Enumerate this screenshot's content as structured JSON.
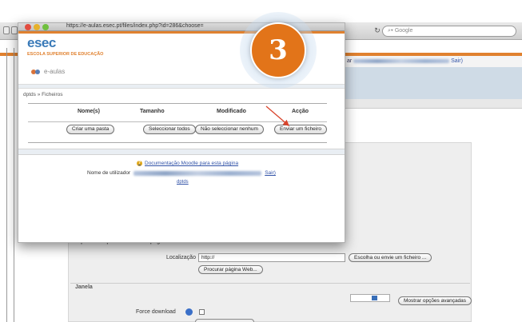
{
  "browser": {
    "url": "https://e-aulas.esec.pt/files/index.php?id=286&choose=",
    "search_placeholder": "Google"
  },
  "background": {
    "user_prefix": "ar",
    "user_suffix": "Sair)",
    "section_title": "Apontador para ficheiro ou página",
    "location_label": "Localização",
    "location_value": "http://",
    "choose_file_button": "Escolha ou envie um ficheiro ...",
    "search_web_button": "Procurar página Web...",
    "window_label": "Janela",
    "advanced_button": "Mostrar opções avançadas",
    "force_download_label": "Force download"
  },
  "popup": {
    "logo": "esec",
    "logo_subtitle": "ESCOLA SUPERIOR DE EDUCAÇÃO",
    "site_name": "e-aulas",
    "breadcrumb": "dptds » Ficheiros",
    "columns": [
      "Nome(s)",
      "Tamanho",
      "Modificado",
      "Acção"
    ],
    "buttons": {
      "create_folder": "Criar uma pasta",
      "select_all": "Seleccionar todos",
      "select_none": "Não seleccionar nenhum",
      "upload_file": "Enviar um ficheiro"
    },
    "doc_link": "Documentação Moodle para esta página",
    "login_label": "Nome de utilizador",
    "logout_link": "Sair)",
    "course_link": "dptds"
  },
  "step_badge": "3",
  "colors": {
    "accent_orange": "#e27419",
    "link_blue": "#3354a8",
    "logo_blue": "#3a7ab8"
  }
}
